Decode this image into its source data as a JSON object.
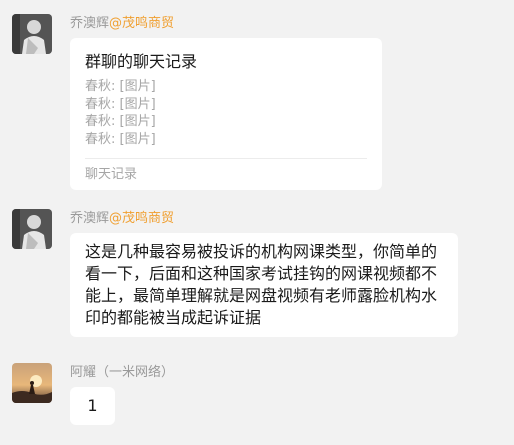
{
  "messages": [
    {
      "sender_name": "乔澳辉",
      "sender_org": "@茂鸣商贸",
      "type": "chat-history-card",
      "card": {
        "title": "群聊的聊天记录",
        "lines": [
          "春秋: [图片]",
          "春秋: [图片]",
          "春秋: [图片]",
          "春秋: [图片]"
        ],
        "footer": "聊天记录"
      }
    },
    {
      "sender_name": "乔澳辉",
      "sender_org": "@茂鸣商贸",
      "type": "text",
      "text": "这是几种最容易被投诉的机构网课类型，你简单的看一下，后面和这种国家考试挂钩的网课视频都不能上，最简单理解就是网盘视频有老师露脸机构水印的都能被当成起诉证据"
    },
    {
      "sender_name": "阿耀（一米网络）",
      "type": "text",
      "text": "1"
    }
  ],
  "colors": {
    "background": "#f2f2f2",
    "bubble": "#ffffff",
    "sender_name": "#999999",
    "sender_org": "#f0a032",
    "message_text": "#1a1a1a",
    "card_secondary": "#a6a6a6"
  }
}
